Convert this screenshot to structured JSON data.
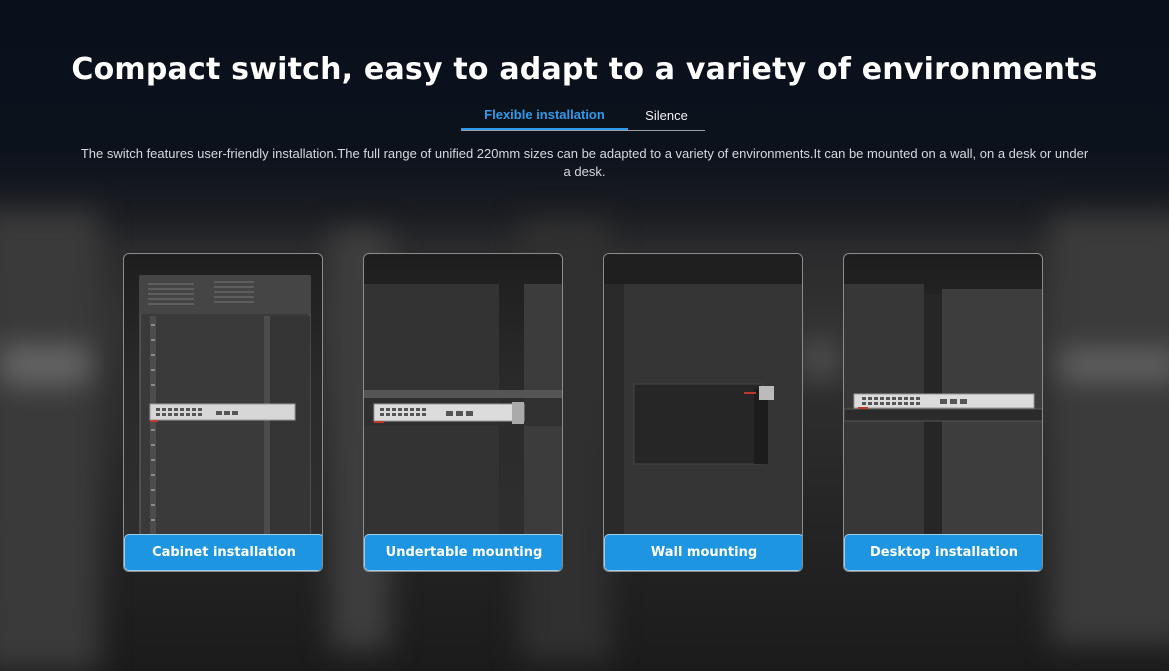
{
  "header": {
    "title": "Compact switch, easy to adapt to a variety of environments"
  },
  "tabs": [
    {
      "label": "Flexible installation",
      "active": true
    },
    {
      "label": "Silence",
      "active": false
    }
  ],
  "description": "The switch features user-friendly installation.The full range of unified 220mm sizes can be adapted to a variety of environments.It can be mounted on a wall, on a desk or under a desk.",
  "cards": [
    {
      "label": "Cabinet installation"
    },
    {
      "label": "Undertable mounting"
    },
    {
      "label": "Wall mounting"
    },
    {
      "label": "Desktop installation"
    }
  ],
  "colors": {
    "accent": "#1e95e0",
    "active_tab": "#2f9be8",
    "background": "#0d121d"
  }
}
